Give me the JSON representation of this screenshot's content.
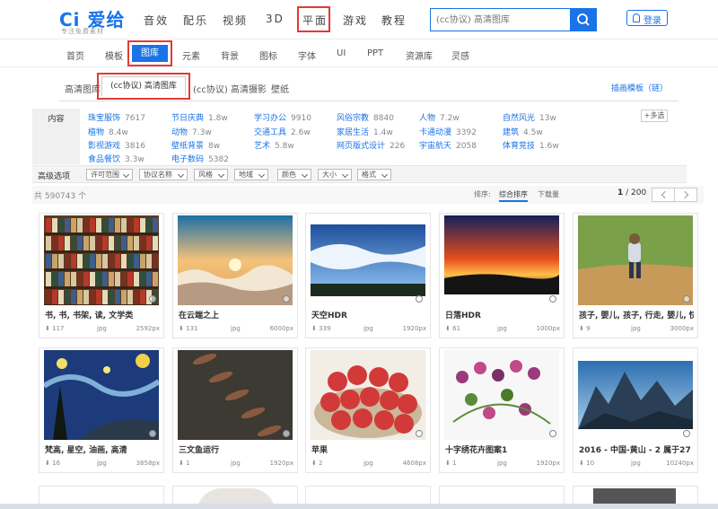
{
  "brand": {
    "logo_text": "爱给",
    "logo_mark": "Ci",
    "tagline": "专注免费素材"
  },
  "top_nav": [
    "音效",
    "配乐",
    "视频",
    "3D",
    "平面",
    "游戏",
    "教程"
  ],
  "search": {
    "placeholder": "(cc协议) 高清图库"
  },
  "login_label": "登录",
  "sub_nav": [
    "首页",
    "模板",
    "图库",
    "元素",
    "背景",
    "图标",
    "字体",
    "UI",
    "PPT",
    "资源库",
    "灵感"
  ],
  "tabs": [
    "高清图库",
    "(cc协议) 高清图库",
    "(cc协议) 高清摄影",
    "壁纸"
  ],
  "tabs_right": "插画模板（链）",
  "filter": {
    "label": "内容",
    "multi": "+多选",
    "items": [
      {
        "name": "珠宝服饰",
        "count": "7617"
      },
      {
        "name": "节日庆典",
        "count": "1.8w"
      },
      {
        "name": "学习办公",
        "count": "9910"
      },
      {
        "name": "风俗宗教",
        "count": "8840"
      },
      {
        "name": "人物",
        "count": "7.2w"
      },
      {
        "name": "自然风光",
        "count": "13w"
      },
      {
        "name": "植物",
        "count": "8.4w"
      },
      {
        "name": "动物",
        "count": "7.3w"
      },
      {
        "name": "交通工具",
        "count": "2.6w"
      },
      {
        "name": "家居生活",
        "count": "1.4w"
      },
      {
        "name": "卡通动漫",
        "count": "3392"
      },
      {
        "name": "建筑",
        "count": "4.5w"
      },
      {
        "name": "影视游戏",
        "count": "3816"
      },
      {
        "name": "壁纸背景",
        "count": "8w"
      },
      {
        "name": "艺术",
        "count": "5.8w"
      },
      {
        "name": "网页版式设计",
        "count": "226"
      },
      {
        "name": "宇宙航天",
        "count": "2058"
      },
      {
        "name": "体育竞技",
        "count": "1.6w"
      },
      {
        "name": "食品餐饮",
        "count": "3.3w"
      },
      {
        "name": "电子数码",
        "count": "5382"
      }
    ]
  },
  "advanced": {
    "label": "高级选项",
    "dropdowns": [
      "许可范围",
      "协议名称",
      "风格",
      "地域",
      "颜色",
      "大小",
      "格式"
    ]
  },
  "sort": {
    "total": "共 590743 个",
    "label": "排序:",
    "active": "综合排序",
    "downloads": "下载量",
    "page_current": "1",
    "page_total": "/ 200"
  },
  "cards": [
    {
      "title": "书, 书, 书架, 读, 文学类",
      "downloads": "117",
      "format": "jpg",
      "size": "2592px",
      "img": "books"
    },
    {
      "title": "在云端之上",
      "downloads": "131",
      "format": "jpg",
      "size": "6000px",
      "img": "clouds"
    },
    {
      "title": "天空HDR",
      "downloads": "339",
      "format": "jpg",
      "size": "1920px",
      "img": "sky"
    },
    {
      "title": "日落HDR",
      "downloads": "61",
      "format": "jpg",
      "size": "1000px",
      "img": "sunset"
    },
    {
      "title": "孩子, 婴儿, 孩子, 行走, 婴儿, 快乐,",
      "downloads": "9",
      "format": "jpg",
      "size": "3000px",
      "img": "child"
    },
    {
      "title": "梵高, 星空, 油画, 高清",
      "downloads": "16",
      "format": "jpg",
      "size": "3858px",
      "img": "starry"
    },
    {
      "title": "三文鱼运行",
      "downloads": "1",
      "format": "jpg",
      "size": "1920px",
      "img": "salmon"
    },
    {
      "title": "苹果",
      "downloads": "2",
      "format": "jpg",
      "size": "4608px",
      "img": "apples"
    },
    {
      "title": "十字绣花卉图案1",
      "downloads": "1",
      "format": "jpg",
      "size": "1920px",
      "img": "cross"
    },
    {
      "title": "2016 - 中国-黄山 - 2 属于27",
      "downloads": "10",
      "format": "jpg",
      "size": "10240px",
      "img": "mountain"
    }
  ]
}
